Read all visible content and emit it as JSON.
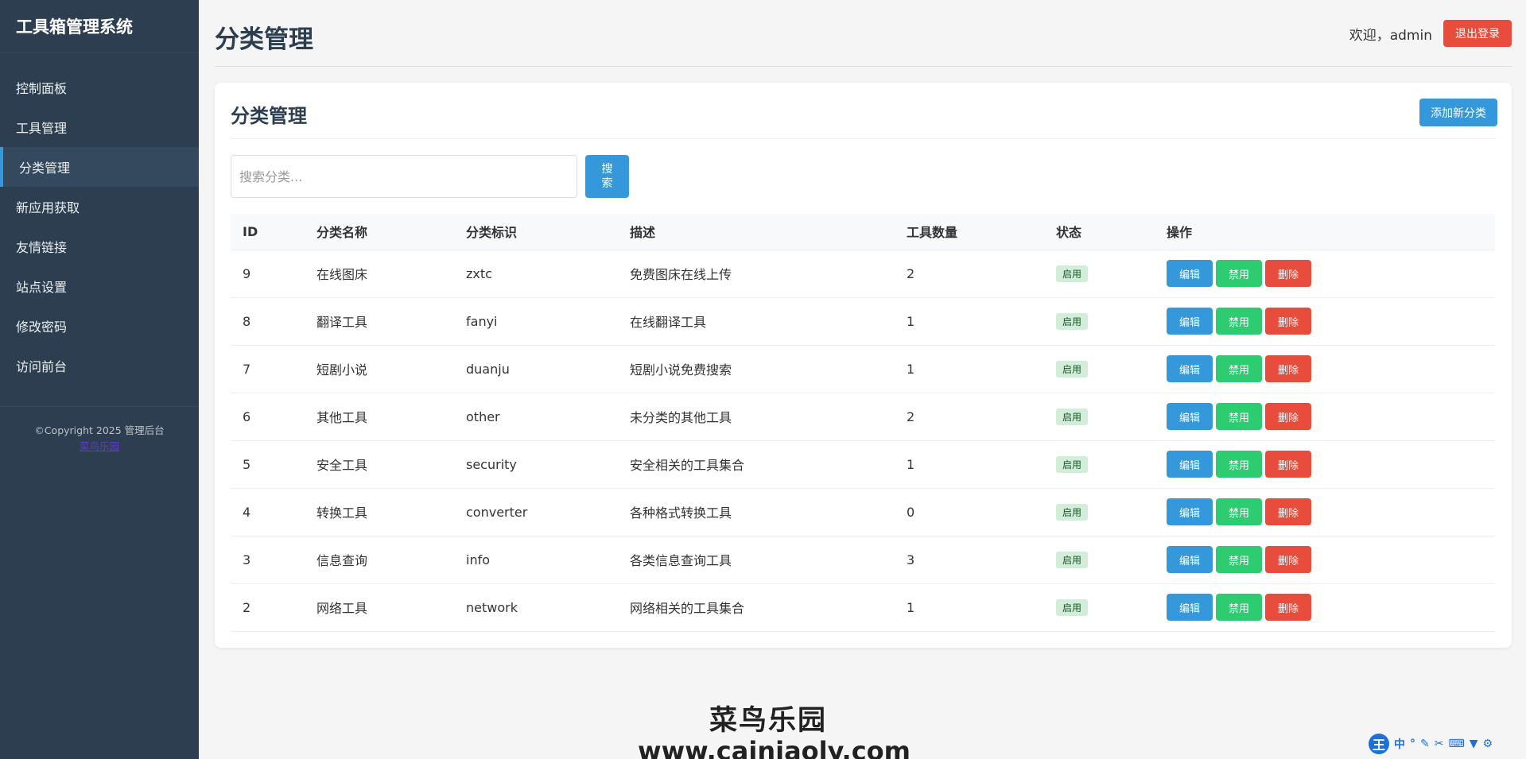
{
  "sidebar": {
    "brand": "工具箱管理系统",
    "items": [
      {
        "label": "控制面板"
      },
      {
        "label": "工具管理"
      },
      {
        "label": "分类管理"
      },
      {
        "label": "新应用获取"
      },
      {
        "label": "友情链接"
      },
      {
        "label": "站点设置"
      },
      {
        "label": "修改密码"
      },
      {
        "label": "访问前台"
      }
    ],
    "active_index": 2,
    "copyright": "©Copyright 2025 管理后台",
    "footer_link": "菜鸟乐园"
  },
  "header": {
    "title": "分类管理",
    "welcome": "欢迎，admin",
    "logout_label": "退出登录"
  },
  "card": {
    "title": "分类管理",
    "add_label": "添加新分类",
    "search": {
      "placeholder": "搜索分类...",
      "value": "",
      "button_label": "搜索"
    }
  },
  "table": {
    "columns": [
      "ID",
      "分类名称",
      "分类标识",
      "描述",
      "工具数量",
      "状态",
      "操作"
    ],
    "rows": [
      {
        "id": "9",
        "name": "在线图床",
        "slug": "zxtc",
        "desc": "免费图床在线上传",
        "count": "2",
        "status": "启用"
      },
      {
        "id": "8",
        "name": "翻译工具",
        "slug": "fanyi",
        "desc": "在线翻译工具",
        "count": "1",
        "status": "启用"
      },
      {
        "id": "7",
        "name": "短剧小说",
        "slug": "duanju",
        "desc": "短剧小说免费搜索",
        "count": "1",
        "status": "启用"
      },
      {
        "id": "6",
        "name": "其他工具",
        "slug": "other",
        "desc": "未分类的其他工具",
        "count": "2",
        "status": "启用"
      },
      {
        "id": "5",
        "name": "安全工具",
        "slug": "security",
        "desc": "安全相关的工具集合",
        "count": "1",
        "status": "启用"
      },
      {
        "id": "4",
        "name": "转换工具",
        "slug": "converter",
        "desc": "各种格式转换工具",
        "count": "0",
        "status": "启用"
      },
      {
        "id": "3",
        "name": "信息查询",
        "slug": "info",
        "desc": "各类信息查询工具",
        "count": "3",
        "status": "启用"
      },
      {
        "id": "2",
        "name": "网络工具",
        "slug": "network",
        "desc": "网络相关的工具集合",
        "count": "1",
        "status": "启用"
      }
    ],
    "actions": {
      "edit": "编辑",
      "disable": "禁用",
      "delete": "删除"
    }
  },
  "watermark": {
    "name": "菜鸟乐园",
    "url": "www.cainiaoly.com"
  },
  "ime": {
    "logo": "王",
    "mode": "中"
  },
  "colors": {
    "sidebar": "#2c3e50",
    "primary": "#3498db",
    "success": "#2ecc71",
    "danger": "#e74c3c"
  }
}
